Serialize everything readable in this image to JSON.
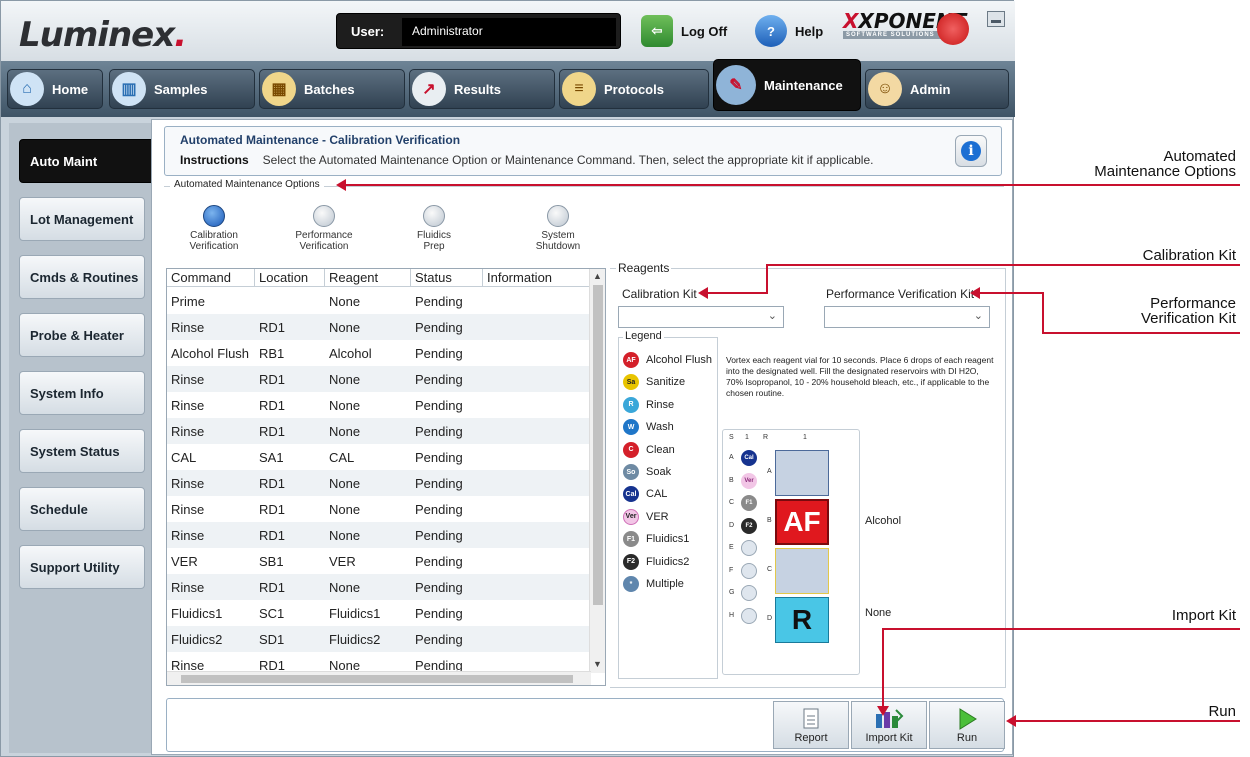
{
  "header": {
    "logo": "Luminex",
    "logo_suffix": ".",
    "user_label": "User:",
    "user_value": "Administrator",
    "logoff": "Log Off",
    "help": "Help",
    "brand": "XPONENT",
    "brand_sub": "SOFTWARE SOLUTIONS"
  },
  "nav": {
    "tabs": [
      {
        "label": "Home"
      },
      {
        "label": "Samples"
      },
      {
        "label": "Batches"
      },
      {
        "label": "Results"
      },
      {
        "label": "Protocols"
      },
      {
        "label": "Maintenance"
      },
      {
        "label": "Admin"
      }
    ],
    "active": "Maintenance"
  },
  "sidebar": {
    "items": [
      {
        "label": "Auto Maint"
      },
      {
        "label": "Lot Management"
      },
      {
        "label": "Cmds & Routines"
      },
      {
        "label": "Probe & Heater"
      },
      {
        "label": "System Info"
      },
      {
        "label": "System Status"
      },
      {
        "label": "Schedule"
      },
      {
        "label": "Support Utility"
      }
    ],
    "active": "Auto Maint"
  },
  "page": {
    "title": "Automated Maintenance - Calibration Verification",
    "instructions_label": "Instructions",
    "instructions": "Select the Automated Maintenance Option or Maintenance Command. Then, select the appropriate kit if applicable."
  },
  "options": {
    "legend": "Automated Maintenance Options",
    "items": [
      {
        "line1": "Calibration",
        "line2": "Verification",
        "selected": true
      },
      {
        "line1": "Performance",
        "line2": "Verification",
        "selected": false
      },
      {
        "line1": "Fluidics",
        "line2": "Prep",
        "selected": false
      },
      {
        "line1": "System",
        "line2": "Shutdown",
        "selected": false
      }
    ]
  },
  "table": {
    "columns": [
      "Command",
      "Location",
      "Reagent",
      "Status",
      "Information"
    ],
    "rows": [
      [
        "Prime",
        "",
        "None",
        "Pending",
        ""
      ],
      [
        "Rinse",
        "RD1",
        "None",
        "Pending",
        ""
      ],
      [
        "Alcohol Flush",
        "RB1",
        "Alcohol",
        "Pending",
        ""
      ],
      [
        "Rinse",
        "RD1",
        "None",
        "Pending",
        ""
      ],
      [
        "Rinse",
        "RD1",
        "None",
        "Pending",
        ""
      ],
      [
        "Rinse",
        "RD1",
        "None",
        "Pending",
        ""
      ],
      [
        "CAL",
        "SA1",
        "CAL",
        "Pending",
        ""
      ],
      [
        "Rinse",
        "RD1",
        "None",
        "Pending",
        ""
      ],
      [
        "Rinse",
        "RD1",
        "None",
        "Pending",
        ""
      ],
      [
        "Rinse",
        "RD1",
        "None",
        "Pending",
        ""
      ],
      [
        "VER",
        "SB1",
        "VER",
        "Pending",
        ""
      ],
      [
        "Rinse",
        "RD1",
        "None",
        "Pending",
        ""
      ],
      [
        "Fluidics1",
        "SC1",
        "Fluidics1",
        "Pending",
        ""
      ],
      [
        "Fluidics2",
        "SD1",
        "Fluidics2",
        "Pending",
        ""
      ],
      [
        "Rinse",
        "RD1",
        "None",
        "Pending",
        ""
      ]
    ]
  },
  "reagents": {
    "label": "Reagents",
    "cal_kit_label": "Calibration Kit",
    "cal_kit_value": "",
    "perf_kit_label": "Performance Verification Kit",
    "perf_kit_value": "",
    "legend_label": "Legend",
    "legend": [
      {
        "abbr": "AF",
        "label": "Alcohol Flush",
        "color": "#d4202a"
      },
      {
        "abbr": "Sa",
        "label": "Sanitize",
        "color": "#e8c400"
      },
      {
        "abbr": "R",
        "label": "Rinse",
        "color": "#3aa7d9"
      },
      {
        "abbr": "W",
        "label": "Wash",
        "color": "#1f76c8"
      },
      {
        "abbr": "C",
        "label": "Clean",
        "color": "#d4202a"
      },
      {
        "abbr": "So",
        "label": "Soak",
        "color": "#6e8aa3"
      },
      {
        "abbr": "Cal",
        "label": "CAL",
        "color": "#16338f"
      },
      {
        "abbr": "Ver",
        "label": "VER",
        "color": "#e080c8"
      },
      {
        "abbr": "F1",
        "label": "Fluidics1",
        "color": "#8a8a8a"
      },
      {
        "abbr": "F2",
        "label": "Fluidics2",
        "color": "#2a2a2a"
      },
      {
        "abbr": "*",
        "label": "Multiple",
        "color": "#5f86ad"
      }
    ],
    "note": "Vortex each reagent vial for 10 seconds. Place 6 drops of each reagent into the designated well. Fill the designated reservoirs with DI H2O, 70% Isopropanol, 10 - 20% household bleach, etc., if applicable to the chosen routine.",
    "plate": {
      "col_s": "S",
      "col_1": "1",
      "col_r": "R",
      "col_r1": "1",
      "rows": [
        {
          "letter": "A",
          "well": "Cal"
        },
        {
          "letter": "B",
          "well": "Ver"
        },
        {
          "letter": "C",
          "well": "F1"
        },
        {
          "letter": "D",
          "well": "F2"
        },
        {
          "letter": "E",
          "well": ""
        },
        {
          "letter": "F",
          "well": ""
        },
        {
          "letter": "G",
          "well": ""
        },
        {
          "letter": "H",
          "well": ""
        }
      ],
      "reservoirs": [
        {
          "letter": "A",
          "text": "",
          "label": ""
        },
        {
          "letter": "B",
          "text": "AF",
          "label": "Alcohol"
        },
        {
          "letter": "C",
          "text": "",
          "label": ""
        },
        {
          "letter": "D",
          "text": "R",
          "label": "None"
        }
      ]
    }
  },
  "buttons": {
    "report": "Report",
    "import_kit": "Import Kit",
    "run": "Run"
  },
  "annotations": {
    "amo_line1": "Automated",
    "amo_line2": "Maintenance Options",
    "cal_kit": "Calibration Kit",
    "perf_line1": "Performance",
    "perf_line2": "Verification Kit",
    "import_kit": "Import Kit",
    "run": "Run"
  },
  "colors": {
    "accent": "#c8102e",
    "active_tab": "#111111",
    "selected_radio": "#1a59b8"
  }
}
